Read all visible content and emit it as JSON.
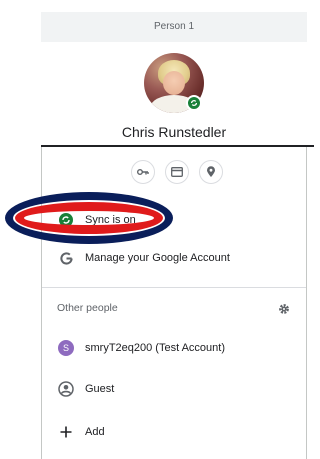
{
  "profile": {
    "header_label": "Person 1",
    "name": "Chris Runstedler"
  },
  "quick_actions": [
    {
      "icon": "key-icon"
    },
    {
      "icon": "credit-card-icon"
    },
    {
      "icon": "location-pin-icon"
    }
  ],
  "menu": {
    "sync_label": "Sync is on",
    "manage_label": "Manage your Google Account"
  },
  "other_people": {
    "section_label": "Other people",
    "accounts": [
      {
        "initial": "S",
        "label": "smryT2eq200 (Test Account)"
      }
    ],
    "guest_label": "Guest",
    "add_label": "Add"
  },
  "colors": {
    "sync_green": "#188038",
    "annotation_red": "#e01b1b",
    "annotation_outline": "#0a1e5a"
  }
}
